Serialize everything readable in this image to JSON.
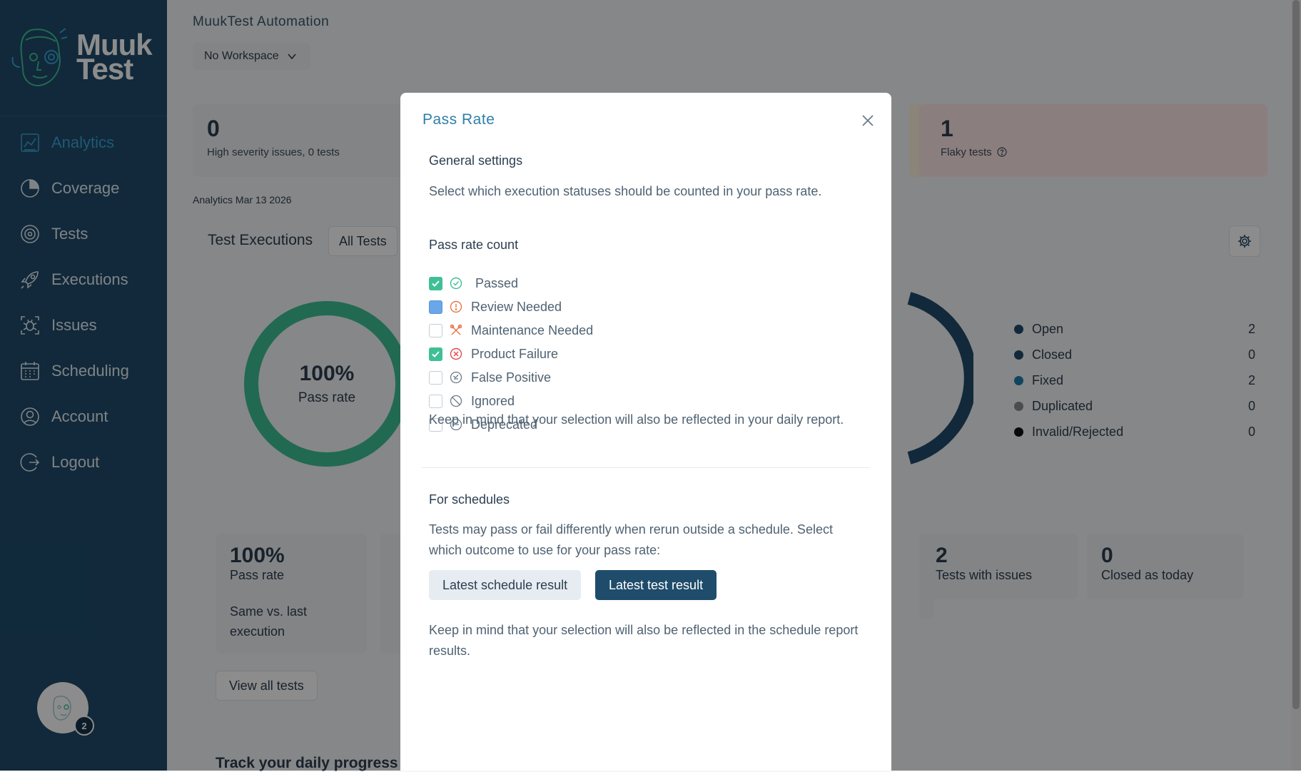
{
  "sidebar": {
    "logo_line1": "Muuk",
    "logo_line2": "Test",
    "items": [
      {
        "label": "Analytics",
        "icon": "analytics-icon",
        "active": true
      },
      {
        "label": "Coverage",
        "icon": "coverage-icon"
      },
      {
        "label": "Tests",
        "icon": "tests-icon"
      },
      {
        "label": "Executions",
        "icon": "rocket-icon"
      },
      {
        "label": "Issues",
        "icon": "bug-icon"
      },
      {
        "label": "Scheduling",
        "icon": "calendar-icon"
      },
      {
        "label": "Account",
        "icon": "user-icon"
      },
      {
        "label": "Logout",
        "icon": "logout-icon"
      }
    ],
    "bot_badge": "2"
  },
  "header": {
    "app_title": "MuukTest Automation",
    "workspace": "No Workspace"
  },
  "stats": {
    "high_severity_num": "0",
    "high_severity_label": "High severity issues, 0 tests",
    "flaky_num": "1",
    "flaky_label": "Flaky tests"
  },
  "analytics_date": "Analytics Mar 13 2026",
  "executions": {
    "title": "Test Executions",
    "filter": "All Tests",
    "donut_value": "100%",
    "donut_label": "Pass rate",
    "pass_fraction": 1.0
  },
  "issues_legend": [
    {
      "label": "Open",
      "value": "2",
      "color": "#1f4c6b"
    },
    {
      "label": "Closed",
      "value": "0",
      "color": "#1f4c6b"
    },
    {
      "label": "Fixed",
      "value": "2",
      "color": "#1f7fae"
    },
    {
      "label": "Duplicated",
      "value": "0",
      "color": "#8a8a8a"
    },
    {
      "label": "Invalid/Rejected",
      "value": "0",
      "color": "#111111"
    }
  ],
  "bottom_cards": {
    "pass_rate_num": "100%",
    "pass_rate_label": "Pass rate",
    "pass_rate_sub": "Same vs. last execution",
    "issues_num": "2",
    "issues_label": "Tests with issues",
    "closed_num": "0",
    "closed_label": "Closed as today"
  },
  "view_all": "View all tests",
  "track_title": "Track your daily progress",
  "modal": {
    "title": "Pass Rate",
    "general_heading": "General settings",
    "general_desc": "Select which execution statuses should be counted in your pass rate.",
    "count_heading": "Pass rate count",
    "options": [
      {
        "label": "Passed",
        "checked": true,
        "icon": "check-circle-icon",
        "color": "#3fbf96"
      },
      {
        "label": "Review Needed",
        "checked": false,
        "hover": true,
        "icon": "alert-circle-icon",
        "color": "#e8764b"
      },
      {
        "label": "Maintenance Needed",
        "checked": false,
        "icon": "tools-icon",
        "color": "#e8764b"
      },
      {
        "label": "Product Failure",
        "checked": true,
        "icon": "x-circle-icon",
        "color": "#e5484d"
      },
      {
        "label": "False Positive",
        "checked": false,
        "icon": "false-positive-icon",
        "color": "#6b7b88"
      },
      {
        "label": "Ignored",
        "checked": false,
        "icon": "ban-icon",
        "color": "#6b7b88"
      },
      {
        "label": "Deprecated",
        "checked": false,
        "icon": "minus-circle-icon",
        "color": "#6b7b88"
      }
    ],
    "daily_note": "Keep in mind that your selection will also be reflected in your daily report.",
    "schedules_heading": "For schedules",
    "schedules_desc": "Tests may pass or fail differently when rerun outside a schedule. Select which outcome to use for your pass rate:",
    "btn_schedule": "Latest schedule result",
    "btn_test": "Latest test result",
    "schedule_note": "Keep in mind that your selection will also be reflected in the schedule report results."
  }
}
